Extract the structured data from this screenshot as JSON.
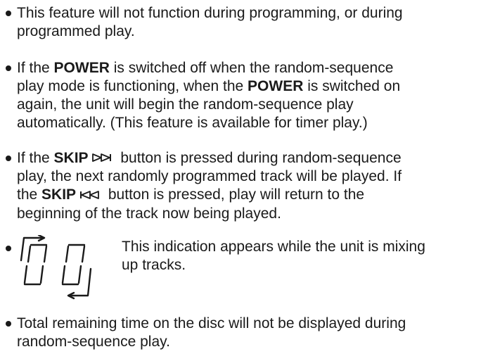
{
  "bullets": [
    {
      "lines": [
        "This feature will not function during programming, or during",
        "programmed play."
      ]
    },
    {
      "line1_a": "If the ",
      "line1_b": "POWER",
      "line1_c": " is switched off when the random-sequence",
      "line2_a": "play mode is functioning, when the ",
      "line2_b": "POWER",
      "line2_c": " is switched on",
      "line3": "again, the unit will begin the random-sequence play",
      "line4": "automatically.  (This feature is available for timer play.)"
    },
    {
      "line1_a": "If the ",
      "line1_b": "SKIP",
      "line1_c": " button is pressed during random-sequence",
      "line2": "play, the next randomly programmed track will be played.  If",
      "line3_a": "the ",
      "line3_b": "SKIP",
      "line3_c": " button is pressed, play will return to the",
      "line4": "beginning of the track now being played.",
      "skip_forward_icon": "skip-forward-icon",
      "skip_back_icon": "skip-back-icon"
    },
    {
      "lines": [
        "This indication appears while the unit is mixing",
        "up tracks."
      ],
      "display_icon": "segment-display-shuffle-icon"
    },
    {
      "lines": [
        "Total remaining time on the disc will not be displayed during",
        "random-sequence play."
      ]
    }
  ]
}
